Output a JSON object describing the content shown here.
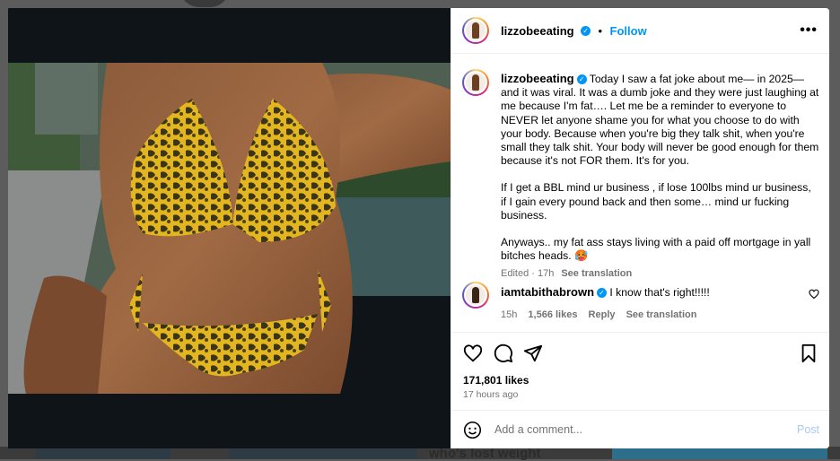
{
  "post": {
    "author": "lizzobeeating",
    "follow_label": "Follow",
    "separator": "•",
    "more_icon": "more-horizontal-icon",
    "caption": {
      "paragraphs": [
        "Today I saw a fat joke about me— in 2025—and it was viral. It was a dumb joke and they were just laughing at me because I'm fat…. Let me be a reminder to everyone to NEVER let anyone shame you for what you choose to do with your body. Because when you're big they talk shit, when you're small they talk shit. Your body will never be good enough for them because it's not FOR them. It's for you.",
        "If I get a BBL mind ur business , if lose 100lbs mind ur business, if I gain every pound back and then some… mind ur fucking business.",
        "Anyways.. my fat ass stays living with a paid off mortgage in yall bitches heads. 🥵"
      ],
      "edited": "Edited · 17h",
      "see_translation": "See translation"
    },
    "comment": {
      "author": "iamtabithabrown",
      "text": "I know that's right!!!!!",
      "age": "15h",
      "likes": "1,566 likes",
      "reply": "Reply",
      "see_translation": "See translation"
    },
    "likes": "171,801 likes",
    "time_ago": "17 hours ago",
    "add_comment_placeholder": "Add a comment...",
    "post_label": "Post"
  },
  "background": {
    "headline": "who's lost weight"
  },
  "colors": {
    "accent": "#0095f6",
    "muted": "#737373",
    "post_disabled": "#a8c7fa",
    "swimsuit": "#e0b21e"
  }
}
